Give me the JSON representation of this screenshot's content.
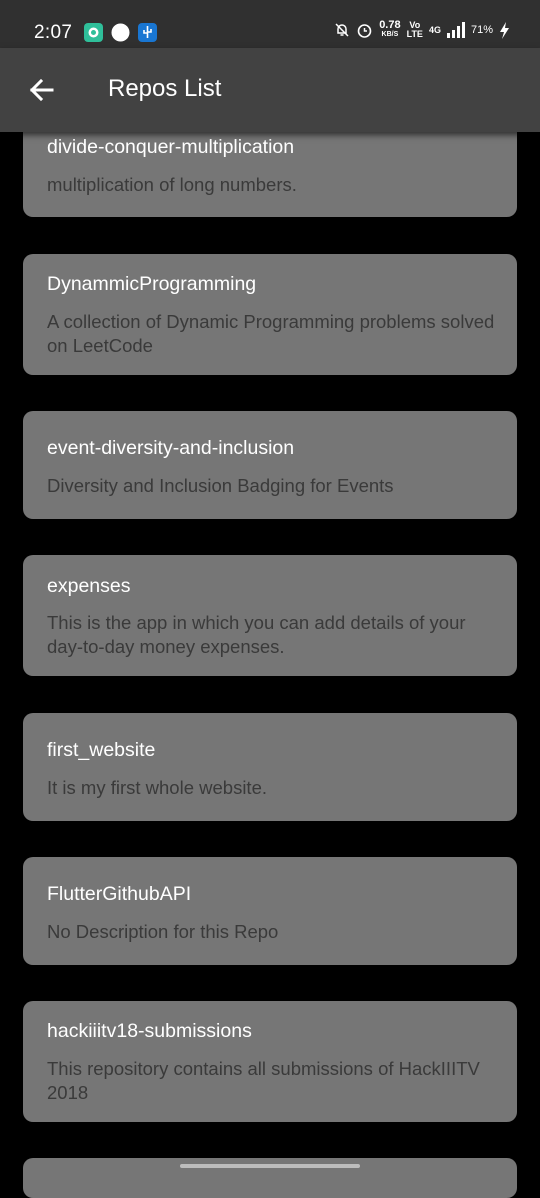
{
  "status_bar": {
    "time": "2:07",
    "net_speed_value": "0.78",
    "net_speed_unit": "KB/S",
    "volte_top": "Vo",
    "volte_bottom": "LTE",
    "network_type": "4G",
    "battery": "71%",
    "icons": [
      "messaging-app-icon",
      "circle-notification-icon",
      "usb-icon",
      "mute-bell-icon",
      "alarm-icon",
      "signal-icon",
      "charging-bolt-icon"
    ]
  },
  "app_bar": {
    "title": "Repos List",
    "back_icon": "arrow-back-icon"
  },
  "repos": [
    {
      "name": "divide-conquer-multiplication",
      "description": "multiplication of long numbers."
    },
    {
      "name": "DynammicProgramming",
      "description": "A collection of Dynamic Programming problems solved on LeetCode"
    },
    {
      "name": "event-diversity-and-inclusion",
      "description": "Diversity and Inclusion Badging for Events"
    },
    {
      "name": "expenses",
      "description": "This is the app in which you can add details of your day-to-day money expenses."
    },
    {
      "name": "first_website",
      "description": "It is my first whole website."
    },
    {
      "name": "FlutterGithubAPI",
      "description": "No Description for this Repo"
    },
    {
      "name": "hackiiitv18-submissions",
      "description": "This repository contains all submissions of HackIIITV 2018"
    }
  ],
  "colors": {
    "app_bar": "#424242",
    "status_bar": "#303030",
    "card": "#767676",
    "background": "#000000"
  }
}
